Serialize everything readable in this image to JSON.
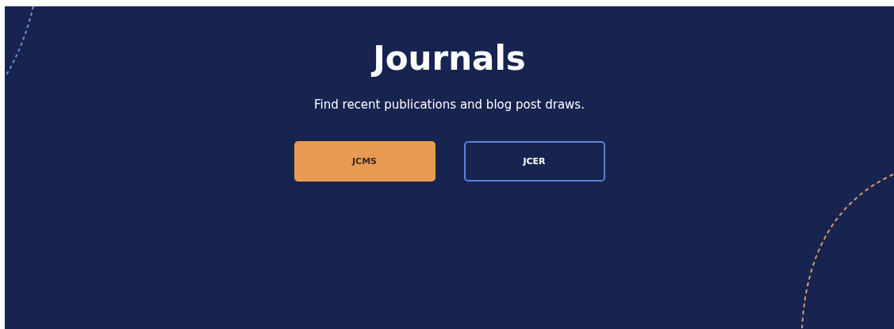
{
  "title": "Journals",
  "subtitle": "Find recent publications and blog post draws.",
  "journals": [
    {
      "label": "JCMS",
      "selected": true
    },
    {
      "label": "JCER",
      "selected": false
    }
  ]
}
